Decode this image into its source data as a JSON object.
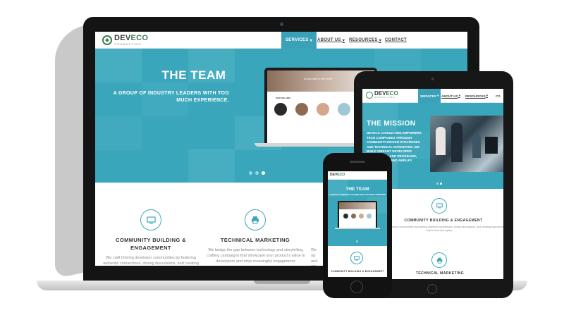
{
  "brand": {
    "name_prefix": "DEV",
    "name_suffix": "ECO",
    "tagline": "CONSULTING",
    "accent": "#3aa6bb",
    "logo_green": "#3e7d55"
  },
  "laptop": {
    "nav": {
      "services": "SERVICES",
      "about": "ABOUT US",
      "resources": "RESOURCES",
      "contact": "CONTACT"
    },
    "hero": {
      "title": "THE TEAM",
      "subtitle": "A GROUP OF INDUSTRY LEADERS WITH TOO MUCH EXPERIENCE."
    },
    "slide": {
      "question": "Do you want to see more?",
      "who_heading": "WHO WE ARE?"
    },
    "features": [
      {
        "icon": "monitor-icon",
        "title": "COMMUNITY BUILDING & ENGAGEMENT",
        "body": "We craft thriving developer communities by fostering authentic connections, driving discussions, and creating"
      },
      {
        "icon": "printer-icon",
        "title": "TECHNICAL MARKETING",
        "body": "We bridge the gap between technology and storytelling, crafting campaigns that showcase your product's value to developers and drive meaningful engagement."
      },
      {
        "icon": "",
        "title": "",
        "body": "We op and SE"
      }
    ]
  },
  "tablet": {
    "nav": {
      "services": "SERVICES",
      "about": "ABOUT US",
      "resources": "RESOURCES",
      "contact": "CO"
    },
    "hero": {
      "title": "THE MISSION",
      "subtitle": "DEVECO CONSULTING EMPOWERS TECH COMPANIES THROUGH COMMUNITY-DRIVEN STRATEGIES AND TECHNICAL MARKETING. WE BUILD VIBRANT DEVELOPER ECOSYSTEMS AND PROGRAMS, ENGAGEMENT, AND AMPLIFY GROWTH."
    },
    "features": [
      {
        "icon": "monitor-icon",
        "title": "COMMUNITY BUILDING & ENGAGEMENT",
        "body": "We craft thriving developer communities by fostering authentic connections, driving discussions, and creating experiences that inspire trust and loyalty."
      },
      {
        "icon": "printer-icon",
        "title": "TECHNICAL MARKETING"
      }
    ]
  },
  "phone": {
    "hero": {
      "title": "THE TEAM",
      "subtitle": "A GROUP OF INDUSTRY LEADERS WITH TOO MUCH EXPERIENCE."
    },
    "features": [
      {
        "icon": "monitor-icon",
        "title": "COMMUNITY BUILDING & ENGAGEMENT"
      }
    ]
  }
}
